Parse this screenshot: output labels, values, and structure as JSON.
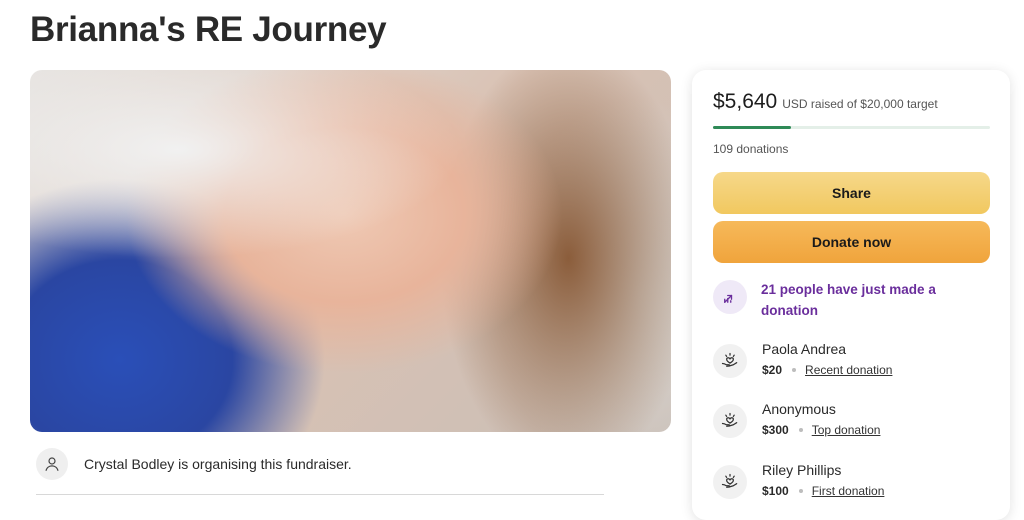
{
  "page": {
    "title": "Brianna's RE Journey"
  },
  "organiser": {
    "text": "Crystal Bodley is organising this fundraiser."
  },
  "summary": {
    "amount_raised": "$5,640",
    "target_text": "USD raised of $20,000 target",
    "progress_fraction": 0.282,
    "donations_count": "109 donations",
    "share_label": "Share",
    "donate_label": "Donate now",
    "trend_text": "21 people have just made a donation"
  },
  "donors": [
    {
      "name": "Paola Andrea",
      "amount": "$20",
      "tag": "Recent donation"
    },
    {
      "name": "Anonymous",
      "amount": "$300",
      "tag": "Top donation"
    },
    {
      "name": "Riley Phillips",
      "amount": "$100",
      "tag": "First donation"
    }
  ],
  "colors": {
    "progress": "#2f8a57",
    "share_button": "#f1c85f",
    "donate_button": "#f0a43c",
    "trend_text": "#6a2e9c"
  },
  "icons": [
    "user-icon",
    "trend-up-icon",
    "donation-heart-hand-icon"
  ]
}
